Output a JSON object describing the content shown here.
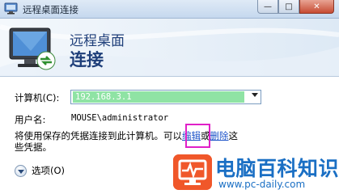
{
  "window": {
    "title": "远程桌面连接",
    "minimize_glyph": "—",
    "maximize_glyph": "□",
    "close_glyph": "✕"
  },
  "banner": {
    "line1": "远程桌面",
    "line2": "连接"
  },
  "form": {
    "computer_label": "计算机(C):",
    "computer_value": "192.168.3.1",
    "username_label": "用户名:",
    "username_value": "MOUSE\\administrator"
  },
  "info": {
    "line1_prefix": "将使用保存的凭据连接到此计算机。可以",
    "edit_link": "编辑",
    "or": "或",
    "delete_link": "删除",
    "line1_suffix": "这",
    "line2": "些凭据。"
  },
  "options": {
    "label": "选项(O)"
  },
  "watermark": {
    "brand": "电脑百科知识",
    "url": "www.pc-daily.com"
  },
  "colors": {
    "accent": "#1f3f7a",
    "selection": "#8fe3a4",
    "link": "#1f55c9",
    "highlight_box": "#e020c8",
    "watermark_logo": "#f0572a",
    "watermark_text": "#1a6fc4"
  }
}
